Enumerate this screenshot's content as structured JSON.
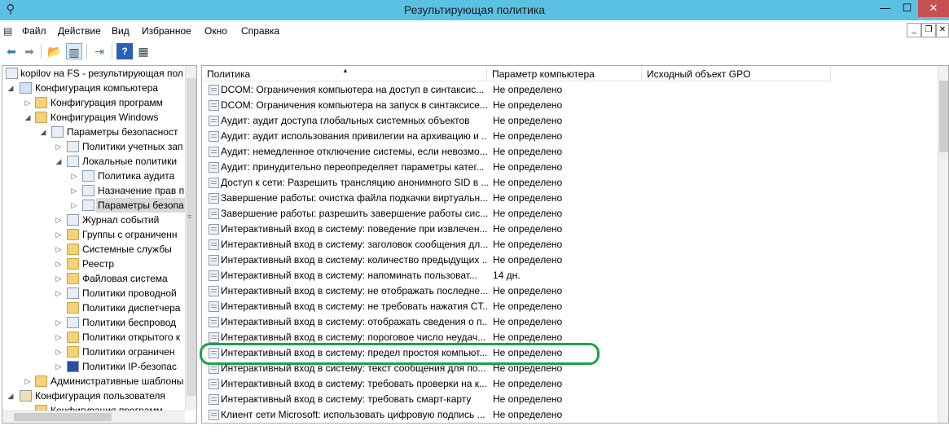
{
  "window": {
    "title": "Результирующая политика",
    "minimize": "—",
    "maximize": "☐",
    "close": "✕"
  },
  "menu": {
    "items": [
      "Файл",
      "Действие",
      "Вид",
      "Избранное",
      "Окно",
      "Справка"
    ]
  },
  "tree": {
    "items": [
      {
        "label": "kopilov на FS - результирующая пол",
        "arrow": "",
        "icon": "rsop-icon"
      },
      {
        "label": "Конфигурация компьютера",
        "arrow": "◢",
        "icon": "computer-icon"
      },
      {
        "label": "Конфигурация программ",
        "arrow": "▷",
        "icon": "folder-icon"
      },
      {
        "label": "Конфигурация Windows",
        "arrow": "◢",
        "icon": "folder-icon"
      },
      {
        "label": "Параметры безопасност",
        "arrow": "◢",
        "icon": "security-icon"
      },
      {
        "label": "Политики учетных зап",
        "arrow": "▷",
        "icon": "policy-icon"
      },
      {
        "label": "Локальные политики",
        "arrow": "◢",
        "icon": "policy-icon"
      },
      {
        "label": "Политика аудита",
        "arrow": "▷",
        "icon": "policy-icon"
      },
      {
        "label": "Назначение прав п",
        "arrow": "▷",
        "icon": "policy-icon"
      },
      {
        "label": "Параметры безопа",
        "arrow": "▷",
        "icon": "policy-icon"
      },
      {
        "label": "Журнал событий",
        "arrow": "▷",
        "icon": "policy-icon"
      },
      {
        "label": "Группы с ограниченн",
        "arrow": "▷",
        "icon": "lock-folder-icon"
      },
      {
        "label": "Системные службы",
        "arrow": "▷",
        "icon": "lock-folder-icon"
      },
      {
        "label": "Реестр",
        "arrow": "▷",
        "icon": "lock-folder-icon"
      },
      {
        "label": "Файловая система",
        "arrow": "▷",
        "icon": "lock-folder-icon"
      },
      {
        "label": "Политики проводной",
        "arrow": "▷",
        "icon": "policy-icon"
      },
      {
        "label": "Политики диспетчера",
        "arrow": "",
        "icon": "folder-icon"
      },
      {
        "label": "Политики беспровод",
        "arrow": "▷",
        "icon": "policy-icon"
      },
      {
        "label": "Политики открытого к",
        "arrow": "▷",
        "icon": "folder-icon"
      },
      {
        "label": "Политики ограничен",
        "arrow": "▷",
        "icon": "folder-icon"
      },
      {
        "label": "Политики IP-безопас",
        "arrow": "▷",
        "icon": "shield-icon"
      },
      {
        "label": "Административные шаблоны",
        "arrow": "▷",
        "icon": "folder-icon"
      },
      {
        "label": "Конфигурация пользователя",
        "arrow": "◢",
        "icon": "user-icon"
      },
      {
        "label": "Конфигурация программ",
        "arrow": "",
        "icon": "folder-icon"
      }
    ]
  },
  "list": {
    "columns": [
      "Политика",
      "Параметр компьютера",
      "Исходный объект GPO"
    ],
    "rows": [
      {
        "policy": "DCOM: Ограничения компьютера на доступ в синтаксис...",
        "value": "Не определено"
      },
      {
        "policy": "DCOM: Ограничения компьютера на запуск в синтаксисе...",
        "value": "Не определено"
      },
      {
        "policy": "Аудит: аудит доступа глобальных системных объектов",
        "value": "Не определено"
      },
      {
        "policy": "Аудит: аудит использования привилегии на архивацию и ...",
        "value": "Не определено"
      },
      {
        "policy": "Аудит: немедленное отключение системы, если невозмо...",
        "value": "Не определено"
      },
      {
        "policy": "Аудит: принудительно переопределяет параметры катег...",
        "value": "Не определено"
      },
      {
        "policy": "Доступ к сети: Разрешить трансляцию анонимного SID в ...",
        "value": "Не определено"
      },
      {
        "policy": "Завершение работы: очистка файла подкачки виртуальн...",
        "value": "Не определено"
      },
      {
        "policy": "Завершение работы: разрешить завершение работы сис...",
        "value": "Не определено"
      },
      {
        "policy": "Интерактивный вход в систему:  поведение при извлечен...",
        "value": "Не определено"
      },
      {
        "policy": "Интерактивный вход в систему: заголовок сообщения дл...",
        "value": "Не определено"
      },
      {
        "policy": "Интерактивный вход в систему: количество предыдущих ...",
        "value": "Не определено"
      },
      {
        "policy": "Интерактивный вход в систему: напоминать пользоват...",
        "value": "14 дн."
      },
      {
        "policy": "Интерактивный вход в систему: не отображать последне...",
        "value": "Не определено"
      },
      {
        "policy": "Интерактивный вход в систему: не требовать нажатия CT...",
        "value": "Не определено"
      },
      {
        "policy": "Интерактивный вход в систему: отображать сведения о п...",
        "value": "Не определено"
      },
      {
        "policy": "Интерактивный вход в систему: пороговое число неудач...",
        "value": "Не определено"
      },
      {
        "policy": "Интерактивный вход в систему: предел простоя компьют...",
        "value": "Не определено"
      },
      {
        "policy": "Интерактивный вход в систему: текст сообщения для по...",
        "value": "Не определено"
      },
      {
        "policy": "Интерактивный вход в систему: требовать проверки на к...",
        "value": "Не определено"
      },
      {
        "policy": "Интерактивный вход в систему: требовать смарт-карту",
        "value": "Не определено"
      },
      {
        "policy": "Клиент сети Microsoft: использовать цифровую подпись ...",
        "value": "Не определено"
      }
    ]
  },
  "colors": {
    "titlebar": "#5bc1e3",
    "close_button": "#c75050",
    "highlight": "#1aa34a"
  }
}
